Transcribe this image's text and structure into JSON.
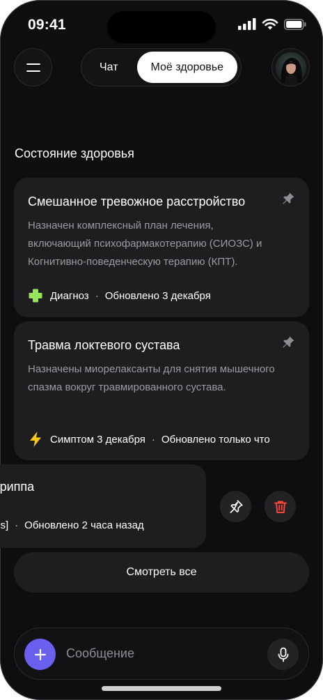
{
  "status_bar": {
    "time": "09:41"
  },
  "header": {
    "tabs": [
      {
        "label": "Чат",
        "active": false
      },
      {
        "label": "Моё здоровье",
        "active": true
      }
    ]
  },
  "section_title": "Состояние здоровья",
  "cards": [
    {
      "title": "Смешанное тревожное расстройство",
      "description": "Назначен комплексный план лечения, включающий психофармакотерапию (СИОЗС) и Когнитивно-поведенческую терапию (КПТ).",
      "type_icon": "plus-icon",
      "type_label": "Диагноз",
      "updated": "Обновлено 3 декабря",
      "type_color": "#9be35a"
    },
    {
      "title": "Травма локтевого сустава",
      "description": "Назначены миорелаксанты для снятия мышечного спазма вокруг травмированного сустава.",
      "type_icon": "lightning-icon",
      "type_label": "Симптом 3 декабря",
      "updated": "Обновлено только что",
      "type_color": "#f5c518"
    }
  ],
  "swiped_card": {
    "title_visible": "гриппа",
    "meta_visible": "ss]",
    "updated": "Обновлено 2 часа назад"
  },
  "see_all_label": "Смотреть все",
  "composer": {
    "placeholder": "Сообщение"
  },
  "colors": {
    "accent": "#6a60f0",
    "delete": "#ff453a",
    "background": "#0e0e10",
    "card": "#1e1e21"
  }
}
